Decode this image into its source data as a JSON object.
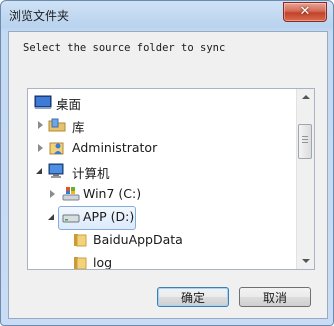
{
  "window": {
    "title": "浏览文件夹",
    "close_label": "✕"
  },
  "dialog": {
    "prompt": "Select the source folder to sync"
  },
  "tree": {
    "items": [
      {
        "label": "桌面",
        "icon": "desktop-icon",
        "state": "none"
      },
      {
        "label": "库",
        "icon": "library-icon",
        "state": "collapsed"
      },
      {
        "label": "Administrator",
        "icon": "user-folder-icon",
        "state": "collapsed"
      },
      {
        "label": "计算机",
        "icon": "computer-icon",
        "state": "expanded"
      },
      {
        "label": "Win7 (C:)",
        "icon": "windows-drive-icon",
        "state": "collapsed"
      },
      {
        "label": "APP (D:)",
        "icon": "drive-icon",
        "state": "expanded",
        "selected": true
      },
      {
        "label": "BaiduAppData",
        "icon": "folder-icon",
        "state": "none"
      },
      {
        "label": "log",
        "icon": "folder-icon",
        "state": "none"
      }
    ]
  },
  "buttons": {
    "ok": "确定",
    "cancel": "取消"
  },
  "colors": {
    "selection_border": "#84acdd",
    "default_button_border": "#3c7fb1"
  }
}
